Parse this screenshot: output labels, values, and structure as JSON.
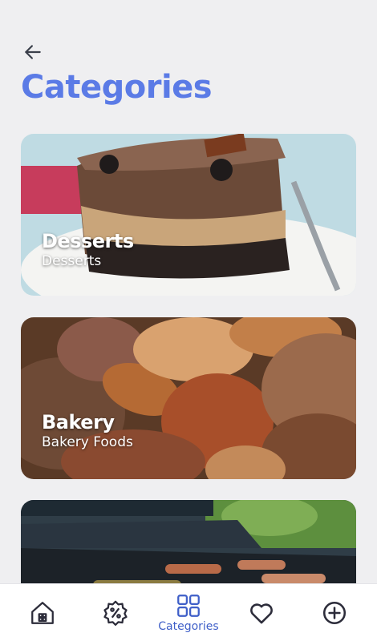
{
  "header": {
    "back_icon": "arrow-left-icon",
    "title": "Categories"
  },
  "categories": [
    {
      "title": "Desserts",
      "subtitle": "Desserts",
      "image": "chocolate-cake-photo"
    },
    {
      "title": "Bakery",
      "subtitle": "Bakery Foods",
      "image": "bread-pastries-photo"
    },
    {
      "title": "",
      "subtitle": "",
      "image": "bbq-grill-photo"
    }
  ],
  "bottom_nav": {
    "items": [
      {
        "icon": "home-icon",
        "label": "",
        "active": false
      },
      {
        "icon": "discount-icon",
        "label": "",
        "active": false
      },
      {
        "icon": "grid-icon",
        "label": "Categories",
        "active": true
      },
      {
        "icon": "heart-icon",
        "label": "",
        "active": false
      },
      {
        "icon": "add-circle-icon",
        "label": "",
        "active": false
      }
    ]
  },
  "colors": {
    "accent": "#5b7be6",
    "nav_active": "#3f5fc8",
    "nav_inactive": "#2c2c3a",
    "background": "#efeff1"
  }
}
